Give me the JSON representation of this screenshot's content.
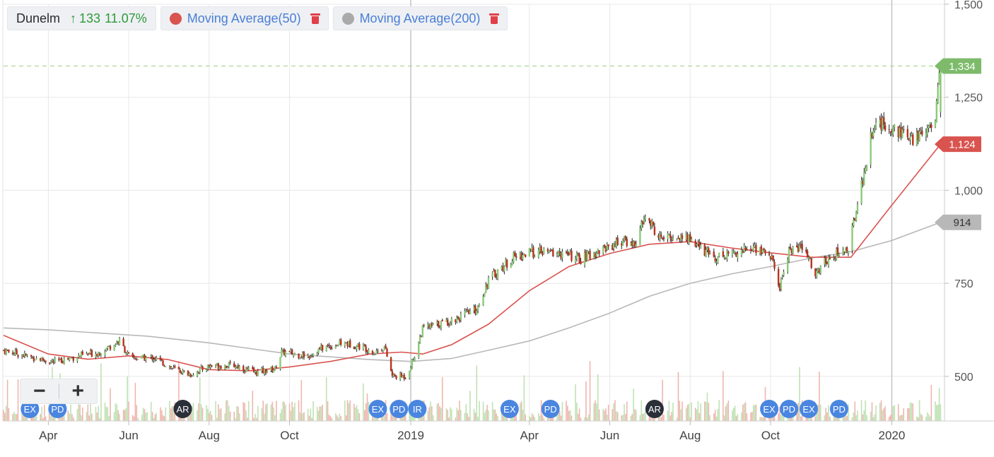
{
  "legend": {
    "symbol": "Dunelm",
    "change_arrow": "↑",
    "change_value": "133",
    "change_pct": "11.07%",
    "ma50_label": "Moving Average(50)",
    "ma50_color": "#d9534f",
    "ma200_label": "Moving Average(200)",
    "ma200_color": "#aaaaaa"
  },
  "zoom": {
    "minus": "−",
    "plus": "+"
  },
  "colors": {
    "up": "#8cc97a",
    "down": "#b8321f",
    "wick": "#222222",
    "grid": "#e8e8e8",
    "price_tag": "#7dbb6b",
    "ma50_tag": "#d9534f",
    "ma200_tag": "#b8b8b8",
    "badge": "#4a86e0",
    "badge_dark": "#2a2f38",
    "volume_up": "#bfe2b4",
    "volume_down": "#efb6ae"
  },
  "chart_data": {
    "type": "candlestick",
    "x_start": "2018-02-26",
    "x_end": "2020-02-10",
    "ylim": [
      380,
      1500
    ],
    "y_ticks": [
      {
        "value": 1500,
        "label": "1,500"
      },
      {
        "value": 1250,
        "label": "1,250"
      },
      {
        "value": 1000,
        "label": "1,000"
      },
      {
        "value": 750,
        "label": "750"
      },
      {
        "value": 500,
        "label": "500"
      }
    ],
    "x_ticks": [
      {
        "date": "2018-04-01",
        "label": "Apr",
        "strong": false
      },
      {
        "date": "2018-06-01",
        "label": "Jun",
        "strong": false
      },
      {
        "date": "2018-08-01",
        "label": "Aug",
        "strong": false
      },
      {
        "date": "2018-10-01",
        "label": "Oct",
        "strong": false
      },
      {
        "date": "2019-01-01",
        "label": "2019",
        "strong": true
      },
      {
        "date": "2019-04-01",
        "label": "Apr",
        "strong": false
      },
      {
        "date": "2019-06-01",
        "label": "Jun",
        "strong": false
      },
      {
        "date": "2019-08-01",
        "label": "Aug",
        "strong": false
      },
      {
        "date": "2019-10-01",
        "label": "Oct",
        "strong": false
      },
      {
        "date": "2020-01-01",
        "label": "2020",
        "strong": true
      }
    ],
    "price_path": [
      [
        "2018-02-26",
        570
      ],
      [
        "2018-03-15",
        555
      ],
      [
        "2018-04-05",
        538
      ],
      [
        "2018-04-25",
        555
      ],
      [
        "2018-05-10",
        565
      ],
      [
        "2018-05-25",
        595
      ],
      [
        "2018-06-02",
        548
      ],
      [
        "2018-06-20",
        550
      ],
      [
        "2018-07-05",
        520
      ],
      [
        "2018-07-18",
        505
      ],
      [
        "2018-08-01",
        528
      ],
      [
        "2018-08-20",
        530
      ],
      [
        "2018-09-05",
        510
      ],
      [
        "2018-09-20",
        520
      ],
      [
        "2018-09-25",
        565
      ],
      [
        "2018-10-15",
        555
      ],
      [
        "2018-10-25",
        575
      ],
      [
        "2018-11-10",
        590
      ],
      [
        "2018-11-25",
        580
      ],
      [
        "2018-12-05",
        565
      ],
      [
        "2018-12-12",
        580
      ],
      [
        "2018-12-18",
        500
      ],
      [
        "2018-12-28",
        500
      ],
      [
        "2019-01-03",
        545
      ],
      [
        "2019-01-10",
        628
      ],
      [
        "2019-02-01",
        650
      ],
      [
        "2019-02-20",
        680
      ],
      [
        "2019-03-01",
        760
      ],
      [
        "2019-03-20",
        820
      ],
      [
        "2019-04-05",
        835
      ],
      [
        "2019-04-25",
        830
      ],
      [
        "2019-05-10",
        815
      ],
      [
        "2019-05-25",
        840
      ],
      [
        "2019-06-10",
        865
      ],
      [
        "2019-06-20",
        855
      ],
      [
        "2019-06-28",
        930
      ],
      [
        "2019-07-10",
        868
      ],
      [
        "2019-07-20",
        875
      ],
      [
        "2019-08-01",
        870
      ],
      [
        "2019-08-10",
        840
      ],
      [
        "2019-08-20",
        820
      ],
      [
        "2019-09-05",
        835
      ],
      [
        "2019-09-20",
        845
      ],
      [
        "2019-10-01",
        825
      ],
      [
        "2019-10-08",
        740
      ],
      [
        "2019-10-15",
        840
      ],
      [
        "2019-10-25",
        845
      ],
      [
        "2019-11-05",
        775
      ],
      [
        "2019-11-15",
        825
      ],
      [
        "2019-11-25",
        835
      ],
      [
        "2019-11-30",
        848
      ],
      [
        "2019-12-05",
        955
      ],
      [
        "2019-12-12",
        1060
      ],
      [
        "2019-12-18",
        1180
      ],
      [
        "2020-01-05",
        1165
      ],
      [
        "2020-01-15",
        1130
      ],
      [
        "2020-01-25",
        1160
      ],
      [
        "2020-02-03",
        1200
      ],
      [
        "2020-02-07",
        1334
      ]
    ],
    "ma50_path": [
      [
        "2018-02-26",
        610
      ],
      [
        "2018-04-01",
        560
      ],
      [
        "2018-05-01",
        546
      ],
      [
        "2018-06-01",
        555
      ],
      [
        "2018-07-01",
        545
      ],
      [
        "2018-08-01",
        518
      ],
      [
        "2018-09-01",
        515
      ],
      [
        "2018-10-01",
        525
      ],
      [
        "2018-11-01",
        540
      ],
      [
        "2018-12-01",
        560
      ],
      [
        "2018-12-25",
        565
      ],
      [
        "2019-01-10",
        560
      ],
      [
        "2019-02-01",
        585
      ],
      [
        "2019-03-01",
        640
      ],
      [
        "2019-04-01",
        730
      ],
      [
        "2019-05-01",
        795
      ],
      [
        "2019-06-01",
        830
      ],
      [
        "2019-07-01",
        855
      ],
      [
        "2019-08-01",
        862
      ],
      [
        "2019-09-01",
        845
      ],
      [
        "2019-10-01",
        832
      ],
      [
        "2019-11-01",
        820
      ],
      [
        "2019-12-01",
        820
      ],
      [
        "2020-01-01",
        960
      ],
      [
        "2020-02-07",
        1124
      ]
    ],
    "ma200_path": [
      [
        "2018-02-26",
        630
      ],
      [
        "2018-04-01",
        625
      ],
      [
        "2018-05-15",
        615
      ],
      [
        "2018-06-15",
        608
      ],
      [
        "2018-08-01",
        590
      ],
      [
        "2018-10-01",
        560
      ],
      [
        "2018-12-01",
        545
      ],
      [
        "2019-01-01",
        540
      ],
      [
        "2019-02-01",
        548
      ],
      [
        "2019-03-01",
        570
      ],
      [
        "2019-04-01",
        595
      ],
      [
        "2019-05-01",
        630
      ],
      [
        "2019-06-01",
        670
      ],
      [
        "2019-07-01",
        715
      ],
      [
        "2019-08-01",
        750
      ],
      [
        "2019-09-01",
        775
      ],
      [
        "2019-10-01",
        795
      ],
      [
        "2019-11-01",
        818
      ],
      [
        "2019-12-01",
        835
      ],
      [
        "2020-01-01",
        865
      ],
      [
        "2020-02-07",
        914
      ]
    ],
    "current": {
      "price": 1334,
      "price_label": "1,334",
      "ma50": 1124,
      "ma50_label": "1,124",
      "ma200": 914,
      "ma200_label": "914"
    },
    "event_badges": [
      {
        "date": "2018-03-18",
        "label": "EX",
        "dark": false
      },
      {
        "date": "2018-04-08",
        "label": "PD",
        "dark": false
      },
      {
        "date": "2018-07-12",
        "label": "AR",
        "dark": true
      },
      {
        "date": "2018-12-07",
        "label": "EX",
        "dark": false
      },
      {
        "date": "2018-12-23",
        "label": "PD",
        "dark": false
      },
      {
        "date": "2019-01-06",
        "label": "IR",
        "dark": false
      },
      {
        "date": "2019-03-17",
        "label": "EX",
        "dark": false
      },
      {
        "date": "2019-04-17",
        "label": "PD",
        "dark": false
      },
      {
        "date": "2019-07-05",
        "label": "AR",
        "dark": true
      },
      {
        "date": "2019-09-30",
        "label": "EX",
        "dark": false
      },
      {
        "date": "2019-10-15",
        "label": "PD",
        "dark": false
      },
      {
        "date": "2019-10-30",
        "label": "EX",
        "dark": false
      },
      {
        "date": "2019-11-22",
        "label": "PD",
        "dark": false
      }
    ]
  }
}
